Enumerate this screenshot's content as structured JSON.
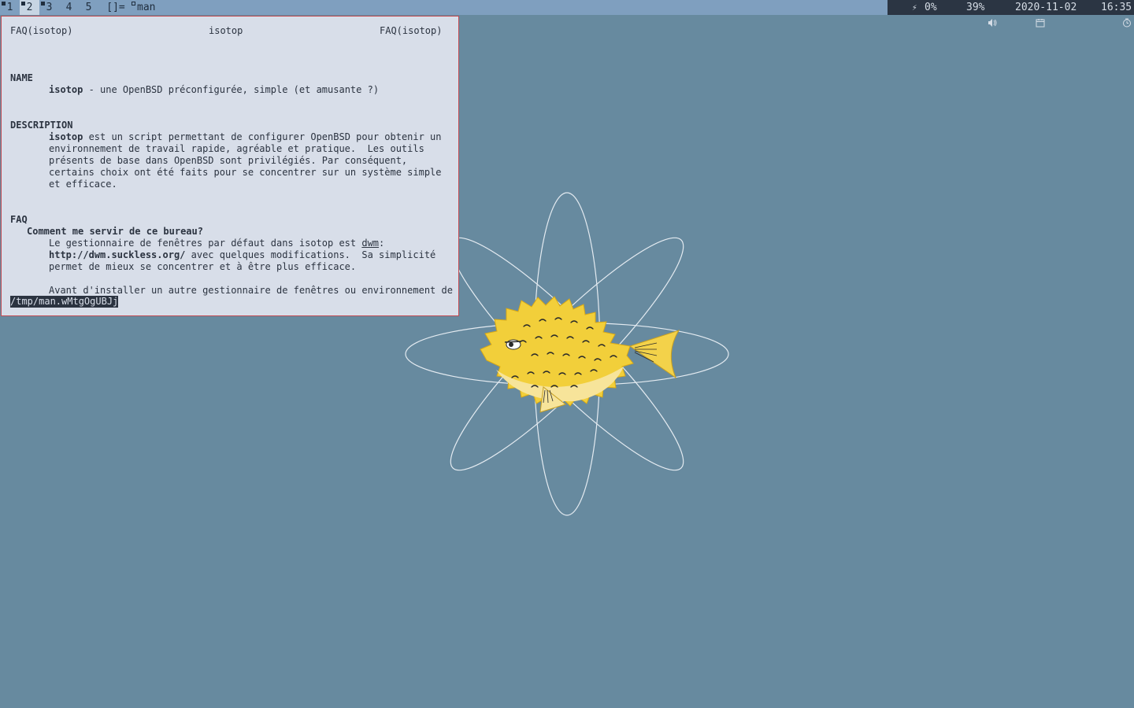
{
  "bar": {
    "tags": [
      {
        "label": "1",
        "active": false,
        "occupied": "filled"
      },
      {
        "label": "2",
        "active": true,
        "occupied": "filled"
      },
      {
        "label": "3",
        "active": false,
        "occupied": "filled"
      },
      {
        "label": "4",
        "active": false,
        "occupied": "none"
      },
      {
        "label": "5",
        "active": false,
        "occupied": "none"
      }
    ],
    "layout_symbol": "[]=",
    "window_title": "man",
    "status": {
      "battery_icon": "bolt-icon",
      "battery": "0%",
      "volume_icon": "speaker-icon",
      "volume": "39%",
      "date_icon": "calendar-icon",
      "date": "2020-11-02",
      "time_icon": "clock-icon",
      "time": "16:35"
    },
    "colors": {
      "bar_bg": "#7f9fbf",
      "status_bg": "#2b3543",
      "active_tag_bg": "#c7d5e3"
    }
  },
  "terminal": {
    "header_left": "FAQ(isotop)",
    "header_center": "isotop",
    "header_right": "FAQ(isotop)",
    "name_heading": "NAME",
    "name_cmd": "isotop",
    "name_desc": " - une OpenBSD préconfigurée, simple (et amusante ?)",
    "desc_heading": "DESCRIPTION",
    "desc_cmd": "isotop",
    "desc_line1": " est un script permettant de configurer OpenBSD pour obtenir un",
    "desc_line2": "environnement de travail rapide, agréable et pratique.  Les outils",
    "desc_line3": "présents de base dans OpenBSD sont privilégiés. Par conséquent,",
    "desc_line4": "certains choix ont été faits pour se concentrer sur un système simple",
    "desc_line5": "et efficace.",
    "faq_heading": "FAQ",
    "faq_question": "Comment me servir de ce bureau?",
    "faq_line1_pre": "Le gestionnaire de fenêtres par défaut dans isotop est ",
    "faq_line1_link": "dwm",
    "faq_line1_post": ":",
    "faq_line2_url": "http://dwm.suckless.org/",
    "faq_line2_post": " avec quelques modifications.  Sa simplicité",
    "faq_line3": "permet de mieux se concentrer et à être plus efficace.",
    "faq_line4": "Avant d'installer un autre gestionnaire de fenêtres ou environnement de",
    "prompt": "/tmp/man.wMtgOgUBJj",
    "colors": {
      "background": "#d8dee9",
      "border": "#c24a52",
      "text": "#2b3340"
    }
  },
  "desktop": {
    "wallpaper_icon": "openbsd-puffy-atom-icon",
    "colors": {
      "background": "#678a9f",
      "puffy": "#f2cf3a"
    }
  }
}
